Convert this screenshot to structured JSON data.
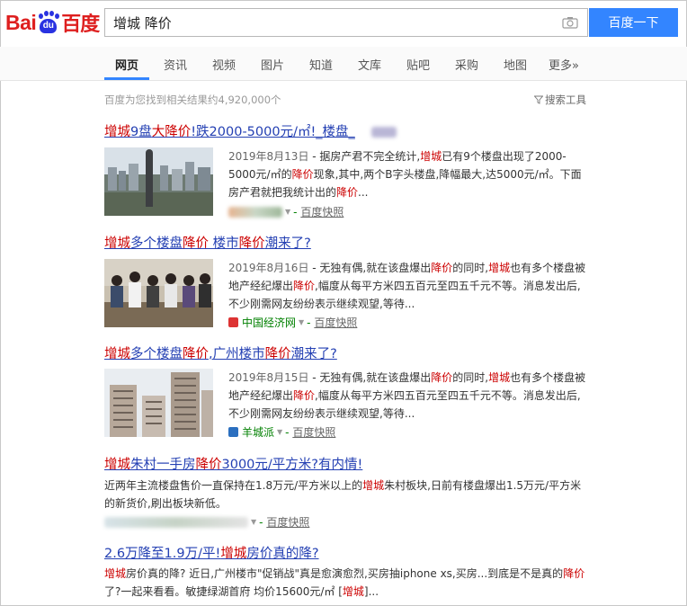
{
  "header": {
    "logo_text_left": "Bai",
    "logo_text_du": "du",
    "logo_text_cn": "百度",
    "search_query": "增城 降价",
    "search_button": "百度一下"
  },
  "tabs": [
    "网页",
    "资讯",
    "视频",
    "图片",
    "知道",
    "文库",
    "贴吧",
    "采购",
    "地图",
    "更多»"
  ],
  "stats": {
    "text": "百度为您找到相关结果约4,920,000个",
    "tools": "搜索工具"
  },
  "results": [
    {
      "title": [
        [
          "kw",
          "增城"
        ],
        [
          "n",
          "9盘"
        ],
        [
          "kw",
          "大降价"
        ],
        [
          "n",
          "!跌2000-5000元/㎡!_楼盘_"
        ]
      ],
      "date": "2019年8月13日",
      "abstract": [
        [
          "n",
          " - 据房产君不完全统计,"
        ],
        [
          "kw",
          "增城"
        ],
        [
          "n",
          "已有9个楼盘出现了2000-5000元/㎡的"
        ],
        [
          "kw",
          "降价"
        ],
        [
          "n",
          "现象,其中,两个B字头楼盘,降幅最大,达5000元/㎡。下面房产君就把我统计出的"
        ],
        [
          "kw",
          "降价"
        ],
        [
          "n",
          "..."
        ]
      ],
      "source": "",
      "snapshot": "百度快照"
    },
    {
      "title": [
        [
          "kw",
          "增城"
        ],
        [
          "n",
          "多个楼盘"
        ],
        [
          "kw",
          "降价"
        ],
        [
          "n",
          " 楼市"
        ],
        [
          "kw",
          "降价"
        ],
        [
          "n",
          "潮来了?"
        ]
      ],
      "date": "2019年8月16日",
      "abstract": [
        [
          "n",
          " - 无独有偶,就在该盘爆出"
        ],
        [
          "kw",
          "降价"
        ],
        [
          "n",
          "的同时,"
        ],
        [
          "kw",
          "增城"
        ],
        [
          "n",
          "也有多个楼盘被地产经纪爆出"
        ],
        [
          "kw",
          "降价"
        ],
        [
          "n",
          ",幅度从每平方米四五百元至四五千元不等。消息发出后,不少刚需网友纷纷表示继续观望,等待..."
        ]
      ],
      "source": "中国经济网",
      "snapshot": "百度快照"
    },
    {
      "title": [
        [
          "kw",
          "增城"
        ],
        [
          "n",
          "多个楼盘"
        ],
        [
          "kw",
          "降价"
        ],
        [
          "n",
          ",广州楼市"
        ],
        [
          "kw",
          "降价"
        ],
        [
          "n",
          "潮来了?"
        ]
      ],
      "date": "2019年8月15日",
      "abstract": [
        [
          "n",
          " - 无独有偶,就在该盘爆出"
        ],
        [
          "kw",
          "降价"
        ],
        [
          "n",
          "的同时,"
        ],
        [
          "kw",
          "增城"
        ],
        [
          "n",
          "也有多个楼盘被地产经纪爆出"
        ],
        [
          "kw",
          "降价"
        ],
        [
          "n",
          ",幅度从每平方米四五百元至四五千元不等。消息发出后,不少刚需网友纷纷表示继续观望,等待..."
        ]
      ],
      "source": "羊城派",
      "snapshot": "百度快照"
    },
    {
      "title": [
        [
          "kw",
          "增城"
        ],
        [
          "n",
          "朱村一手房"
        ],
        [
          "kw",
          "降价"
        ],
        [
          "n",
          "3000元/平方米?有内情!"
        ]
      ],
      "date": "",
      "abstract": [
        [
          "n",
          "近两年主流楼盘售价一直保持在1.8万元/平方米以上的"
        ],
        [
          "kw",
          "增城"
        ],
        [
          "n",
          "朱村板块,日前有楼盘爆出1.5万元/平方米的新货价,刷出板块新低。"
        ]
      ],
      "source": "",
      "snapshot": "百度快照"
    },
    {
      "title": [
        [
          "n",
          "2.6万降至1.9万/平!"
        ],
        [
          "kw",
          "增城"
        ],
        [
          "n",
          "房价真的降?"
        ]
      ],
      "date": "",
      "abstract": [
        [
          "kw",
          "增城"
        ],
        [
          "n",
          "房价真的降? 近日,广州楼市\"促销战\"真是愈演愈烈,买房抽iphone xs,买房...到底是不是真的"
        ],
        [
          "kw",
          "降价"
        ],
        [
          "n",
          "了?一起来看看。敏捷绿湖首府 均价15600元/㎡ ["
        ],
        [
          "kw",
          "增城"
        ],
        [
          "n",
          "]..."
        ]
      ],
      "source": "",
      "snapshot": ""
    }
  ],
  "colors": {
    "brand_red": "#de1f1f",
    "brand_blue": "#2932e1",
    "link": "#2440b3",
    "keyword": "#cc0000",
    "button": "#3385ff"
  }
}
